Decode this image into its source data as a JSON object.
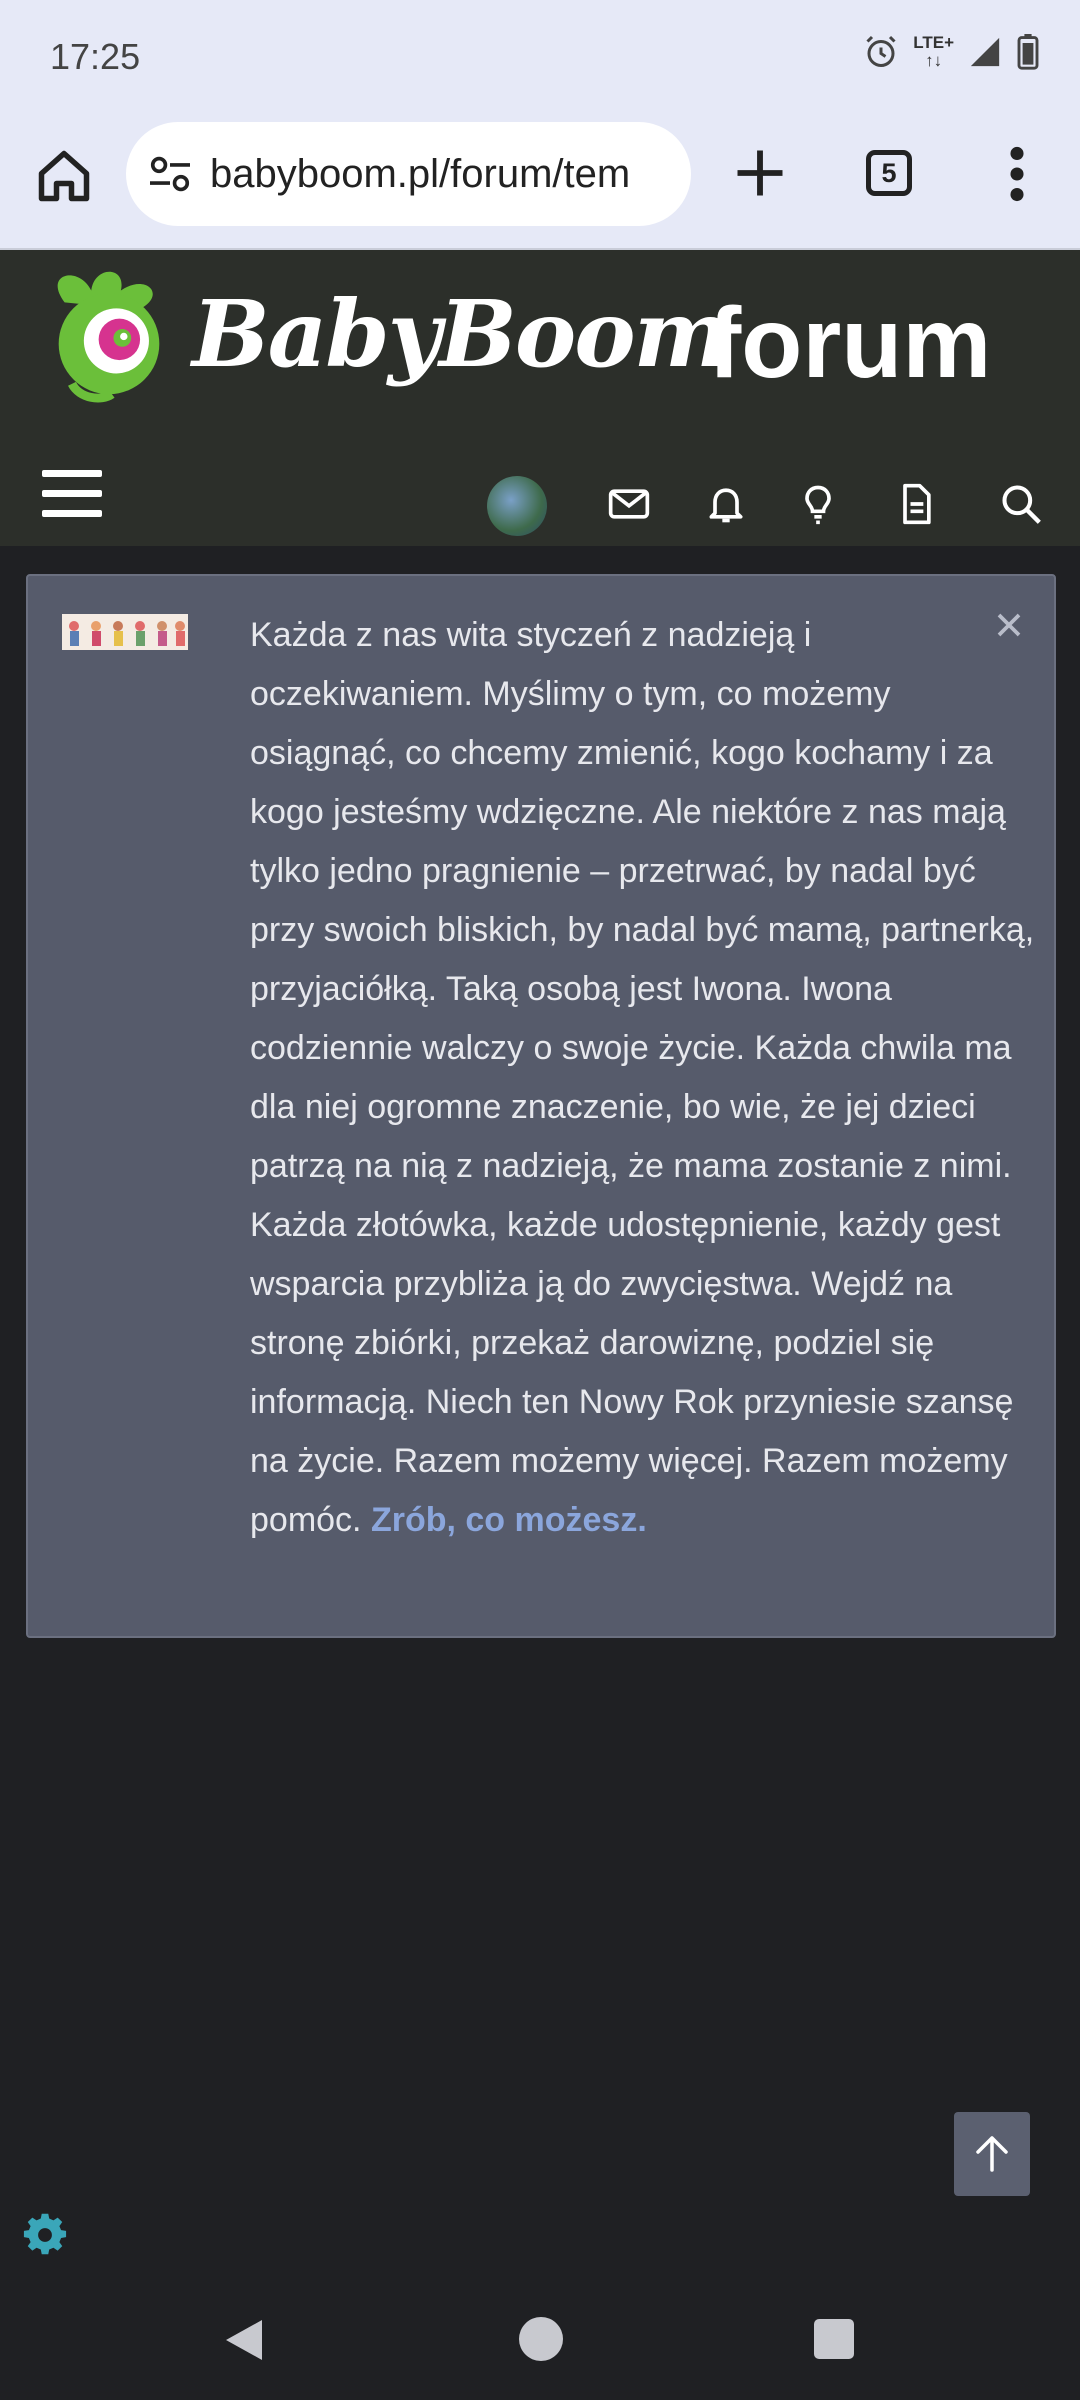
{
  "status_bar": {
    "time": "17:25",
    "network": "LTE+"
  },
  "browser": {
    "url": "babyboom.pl/forum/tem",
    "tab_count": "5"
  },
  "site": {
    "logo_text": "BabyBoom",
    "logo_suffix": "forum"
  },
  "nav_icons": [
    "menu-icon",
    "avatar",
    "mail-icon",
    "bell-icon",
    "lightbulb-icon",
    "document-icon",
    "search-icon"
  ],
  "notice": {
    "body": "Każda z nas wita styczeń z nadzieją i oczekiwaniem. Myślimy o tym, co możemy osiągnąć, co chcemy zmienić, kogo kochamy i za kogo jesteśmy wdzięczne. Ale niektóre z nas mają tylko jedno pragnienie – przetrwać, by nadal być przy swoich bliskich, by nadal być mamą, partnerką, przyjaciółką. Taką osobą jest Iwona. Iwona codziennie walczy o swoje życie. Każda chwila ma dla niej ogromne znaczenie, bo wie, że jej dzieci patrzą na nią z nadzieją, że mama zostanie z nimi. Każda złotówka, każde udostępnienie, każdy gest wsparcia przybliża ją do zwycięstwa. Wejdź na stronę zbiórki, przekaż darowiznę, podziel się informacją. Niech ten Nowy Rok przyniesie szansę na życie. Razem możemy więcej. Razem możemy pomóc. ",
    "link": "Zrób, co możesz."
  },
  "colors": {
    "header_bg": "#2c2f2a",
    "page_bg": "#1f2023",
    "card_bg": "#565b6b",
    "link": "#8ba6dc",
    "logo_green": "#6bbf3a",
    "logo_pink": "#d6338f"
  }
}
